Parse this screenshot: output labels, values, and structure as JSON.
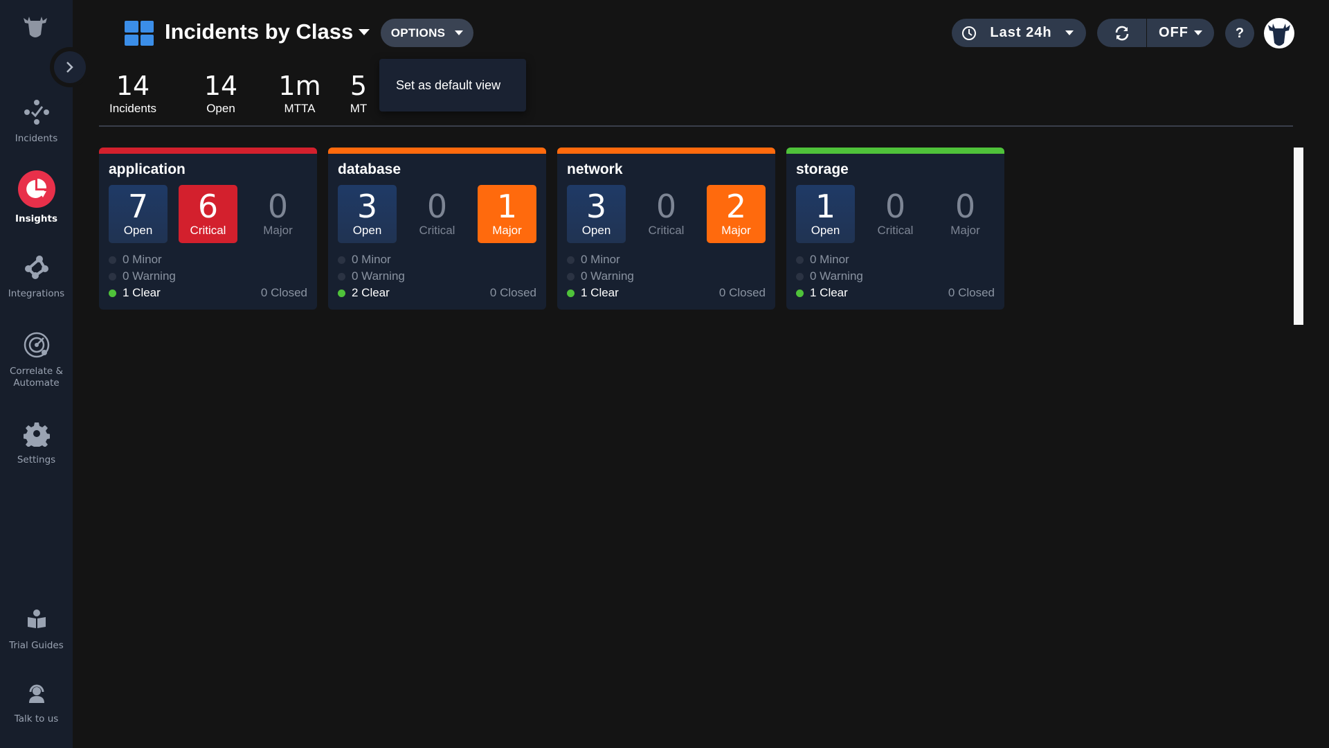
{
  "sidebar": {
    "logo": "cow-head-logo",
    "collapse_icon": "chevron-right-icon",
    "items": [
      {
        "label": "Incidents",
        "icon": "incidents-icon",
        "active": false
      },
      {
        "label": "Insights",
        "icon": "pie-chart-icon",
        "active": true
      },
      {
        "label": "Integrations",
        "icon": "integrations-icon",
        "active": false
      },
      {
        "label": "Correlate & Automate",
        "icon": "radar-icon",
        "active": false
      },
      {
        "label": "Settings",
        "icon": "gear-icon",
        "active": false
      },
      {
        "label": "Trial Guides",
        "icon": "book-reader-icon",
        "active": false
      },
      {
        "label": "Talk to us",
        "icon": "headset-icon",
        "active": false
      }
    ]
  },
  "header": {
    "title": "Incidents by Class",
    "options_label": "OPTIONS",
    "options_menu": [
      "Set as default view"
    ],
    "time_range": "Last 24h",
    "refresh_label": "OFF",
    "help_label": "?"
  },
  "stats": [
    {
      "value": "14",
      "label": "Incidents"
    },
    {
      "value": "14",
      "label": "Open"
    },
    {
      "value": "1m",
      "label": "MTTA"
    },
    {
      "value": "5",
      "label": "MT"
    }
  ],
  "colors": {
    "critical": "#d3202d",
    "major": "#ff6a0d",
    "clear": "#4fc23a",
    "accent": "#3b8ee8",
    "insights_active": "#e8304a"
  },
  "cards": [
    {
      "name": "application",
      "status_color": "#d3202d",
      "open": "7",
      "critical": "6",
      "major": "0",
      "open_label": "Open",
      "critical_label": "Critical",
      "major_label": "Major",
      "minor": "0 Minor",
      "warning": "0 Warning",
      "clear": "1 Clear",
      "closed": "0 Closed"
    },
    {
      "name": "database",
      "status_color": "#ff6a0d",
      "open": "3",
      "critical": "0",
      "major": "1",
      "open_label": "Open",
      "critical_label": "Critical",
      "major_label": "Major",
      "minor": "0 Minor",
      "warning": "0 Warning",
      "clear": "2 Clear",
      "closed": "0 Closed"
    },
    {
      "name": "network",
      "status_color": "#ff6a0d",
      "open": "3",
      "critical": "0",
      "major": "2",
      "open_label": "Open",
      "critical_label": "Critical",
      "major_label": "Major",
      "minor": "0 Minor",
      "warning": "0 Warning",
      "clear": "1 Clear",
      "closed": "0 Closed"
    },
    {
      "name": "storage",
      "status_color": "#4fc23a",
      "open": "1",
      "critical": "0",
      "major": "0",
      "open_label": "Open",
      "critical_label": "Critical",
      "major_label": "Major",
      "minor": "0 Minor",
      "warning": "0 Warning",
      "clear": "1 Clear",
      "closed": "0 Closed"
    }
  ]
}
